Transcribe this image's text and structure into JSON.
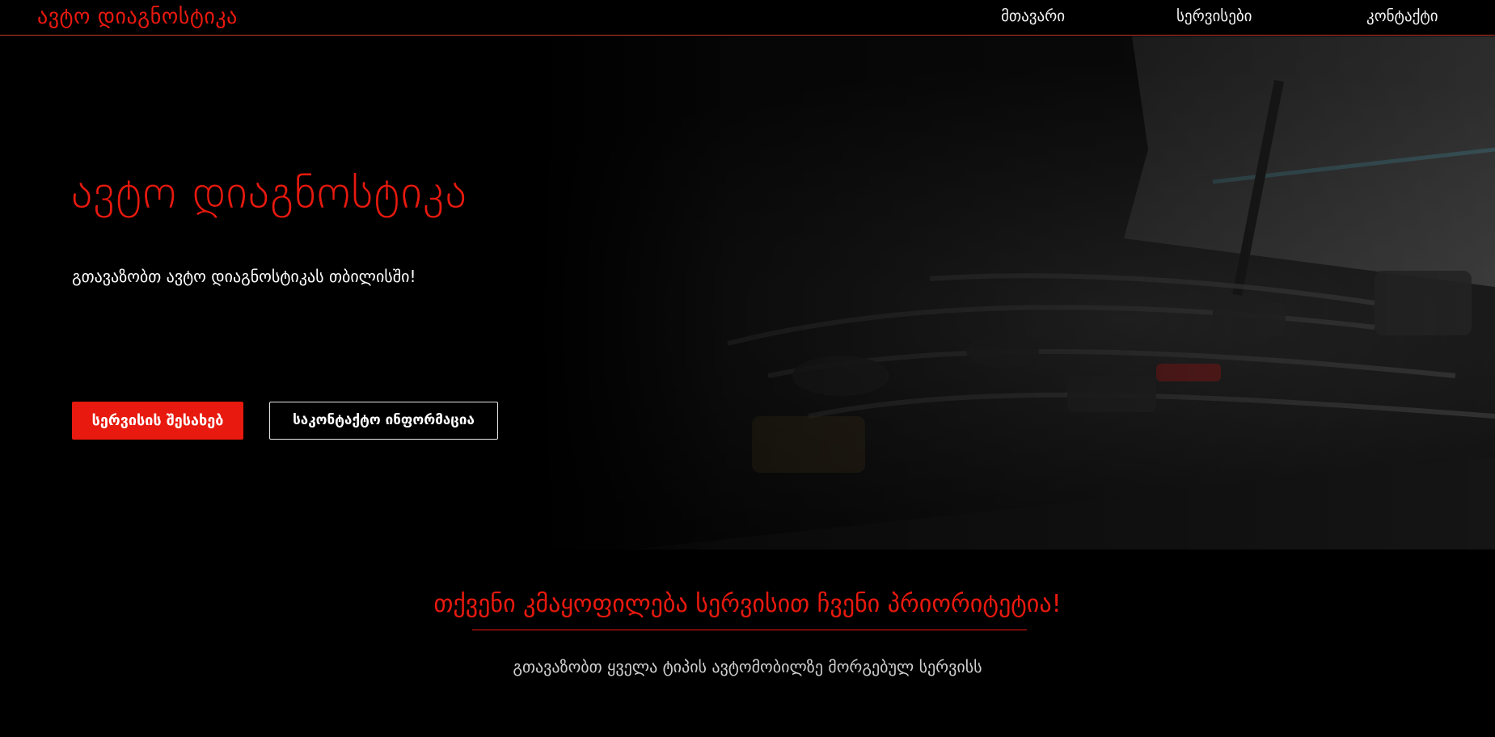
{
  "header": {
    "brand": "ავტო დიაგნოსტიკა",
    "nav": {
      "home": "მთავარი",
      "services": "სერვისები",
      "contact": "კონტაქტი"
    }
  },
  "hero": {
    "title": "ავტო დიაგნოსტიკა",
    "subtitle": "გთავაზობთ ავტო დიაგნოსტიკას თბილისში!",
    "primary_button": "სერვისის შესახებ",
    "secondary_button": "საკონტაქტო ინფორმაცია",
    "background_image": "car-engine-bay"
  },
  "promo": {
    "title": "თქვენი კმაყოფილება სერვისით ჩვენი პრიორიტეტია!",
    "text": "გთავაზობთ ყველა ტიპის ავტომობილზე მორგებულ სერვისს"
  },
  "colors": {
    "accent": "#e8190e",
    "background": "#000000",
    "text": "#ffffff"
  }
}
